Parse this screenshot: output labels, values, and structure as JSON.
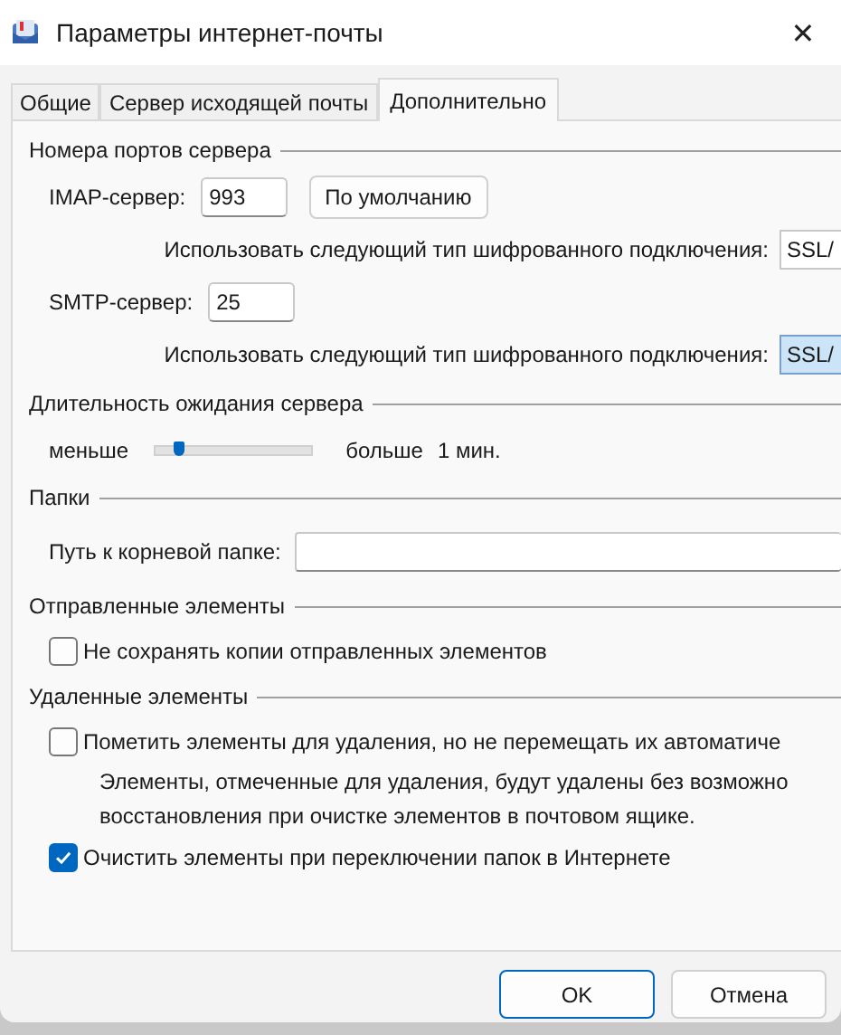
{
  "window": {
    "title": "Параметры интернет-почты",
    "close": "✕"
  },
  "tabs": [
    {
      "label": "Общие",
      "selected": false
    },
    {
      "label": "Сервер исходящей почты",
      "selected": false
    },
    {
      "label": "Дополнительно",
      "selected": true
    }
  ],
  "sections": [
    {
      "title": "Номера портов сервера",
      "rows": [
        {
          "kind": "port",
          "label": "IMAP-сервер:",
          "value": "993",
          "button": "По умолчанию"
        },
        {
          "kind": "encryption",
          "label": "Использовать следующий тип шифрованного подключения:",
          "value": "SSL/",
          "focused": false
        },
        {
          "kind": "port",
          "label": "SMTP-сервер:",
          "value": "25"
        },
        {
          "kind": "encryption",
          "label": "Использовать следующий тип шифрованного подключения:",
          "value": "SSL/",
          "focused": true
        }
      ]
    },
    {
      "title": "Длительность ожидания сервера",
      "rows": [
        {
          "kind": "slider",
          "min_label": "меньше",
          "max_label": "больше",
          "reading": "1 мин.",
          "level": 0.11
        }
      ]
    },
    {
      "title": "Папки",
      "rows": [
        {
          "kind": "path",
          "label": "Путь к корневой папке:"
        }
      ]
    },
    {
      "title": "Отправленные элементы",
      "rows": [
        {
          "kind": "checkbox",
          "label": "Не сохранять копии отправленных элементов",
          "checked": false
        }
      ]
    },
    {
      "title": "Удаленные элементы",
      "rows": [
        {
          "kind": "checkbox",
          "label": "Пометить элементы для удаления, но не перемещать их автоматиче",
          "checked": false
        },
        {
          "kind": "note",
          "text": "Элементы, отмеченные для удаления, будут удалены без возможно восстановления при очистке элементов в почтовом ящике."
        },
        {
          "kind": "checkbox",
          "label": "Очистить элементы при переключении папок в Интернете",
          "checked": true
        }
      ]
    }
  ],
  "buttons": [
    {
      "label": "OK",
      "default": true
    },
    {
      "label": "Отмена",
      "default": false
    }
  ]
}
